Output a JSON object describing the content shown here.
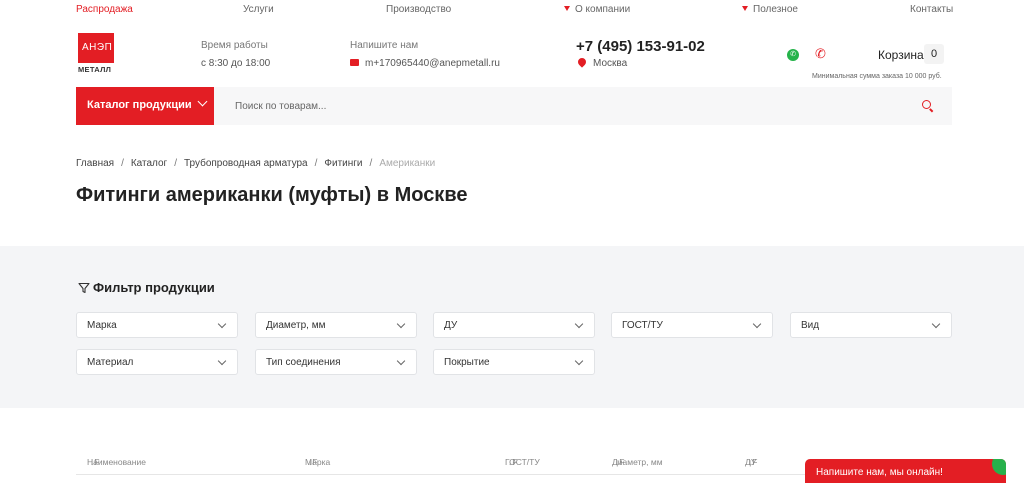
{
  "topnav": {
    "sale": "Распродажа",
    "services": "Услуги",
    "production": "Производство",
    "about": "О компании",
    "useful": "Полезное",
    "contacts": "Контакты"
  },
  "logo": {
    "mark": "АНЭП",
    "sub": "МЕТАЛЛ"
  },
  "header": {
    "hours_label": "Время работы",
    "hours_value": "с 8:30 до 18:00",
    "write_label": "Напишите нам",
    "email": "m+170965440@anepmetall.ru",
    "phone": "+7 (495) 153-91-02",
    "city": "Москва",
    "cart_label": "Корзина",
    "cart_count": "0",
    "min_order": "Минимальная сумма заказа 10 000 руб."
  },
  "search": {
    "catalog_label": "Каталог продукции",
    "placeholder": "Поиск по товарам..."
  },
  "breadcrumb": [
    "Главная",
    "Каталог",
    "Трубопроводная арматура",
    "Фитинги",
    "Американки"
  ],
  "page_title": "Фитинги американки (муфты) в Москве",
  "filter": {
    "title": "Фильтр продукции",
    "row1": [
      "Марка",
      "Диаметр, мм",
      "ДУ",
      "ГОСТ/ТУ",
      "Вид"
    ],
    "row2": [
      "Материал",
      "Тип соединения",
      "Покрытие"
    ]
  },
  "table": {
    "columns": [
      "Наименование",
      "Марка",
      "ГОСТ/ТУ",
      "Диаметр, мм",
      "ДУ"
    ],
    "sort_glyph": "↓F"
  },
  "chat": {
    "label": "Напишите нам, мы онлайн!"
  },
  "colors": {
    "accent": "#e31e24",
    "whatsapp": "#25b34a",
    "filter_bg": "#f4f5f7"
  }
}
